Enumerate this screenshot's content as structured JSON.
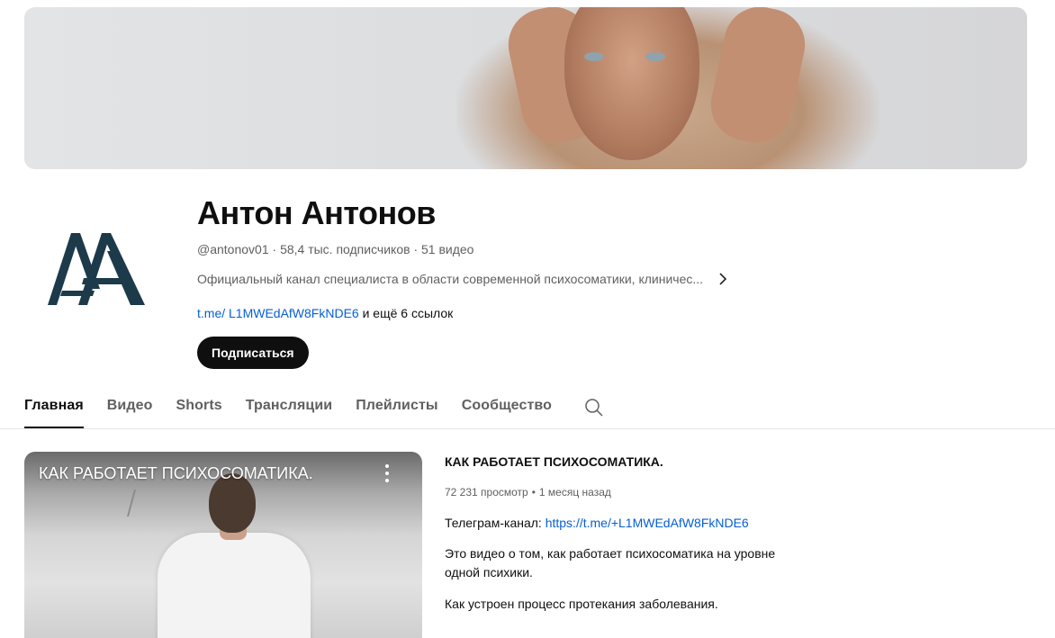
{
  "channel": {
    "name": "Антон Антонов",
    "handle": "@antonov01",
    "subscribers": "58,4 тыс. подписчиков",
    "video_count": "51 видео",
    "separator": "·",
    "description": "Официальный канал специалиста в области современной психосоматики, клиничес...",
    "link_text": "t.me/ L1MWEdAfW8FkNDE6",
    "more_links": "и ещё 6 ссылок",
    "subscribe_label": "Подписаться",
    "avatar_icon": "channel-logo-aa",
    "brand_color": "#1c3a4a"
  },
  "tabs": [
    {
      "label": "Главная",
      "active": true
    },
    {
      "label": "Видео",
      "active": false
    },
    {
      "label": "Shorts",
      "active": false
    },
    {
      "label": "Трансляции",
      "active": false
    },
    {
      "label": "Плейлисты",
      "active": false
    },
    {
      "label": "Сообщество",
      "active": false
    }
  ],
  "featured_video": {
    "thumb_title": "КАК РАБОТАЕТ ПСИХОСОМАТИКА.",
    "title": "КАК РАБОТАЕТ ПСИХОСОМАТИКА.",
    "views": "72 231 просмотр",
    "stats_separator": "•",
    "published": "1 месяц назад",
    "telegram_prefix": "Телеграм-канал: ",
    "telegram_link": "https://t.me/+L1MWEdAfW8FkNDE6",
    "para1_line1": "Это видео о том, как работает психосоматика на уровне",
    "para1_line2": "одной психики.",
    "para2": "Как устроен процесс протекания заболевания."
  },
  "icons": {
    "search": "search-icon",
    "chevron": "chevron-right-icon",
    "more": "more-vert-icon"
  }
}
